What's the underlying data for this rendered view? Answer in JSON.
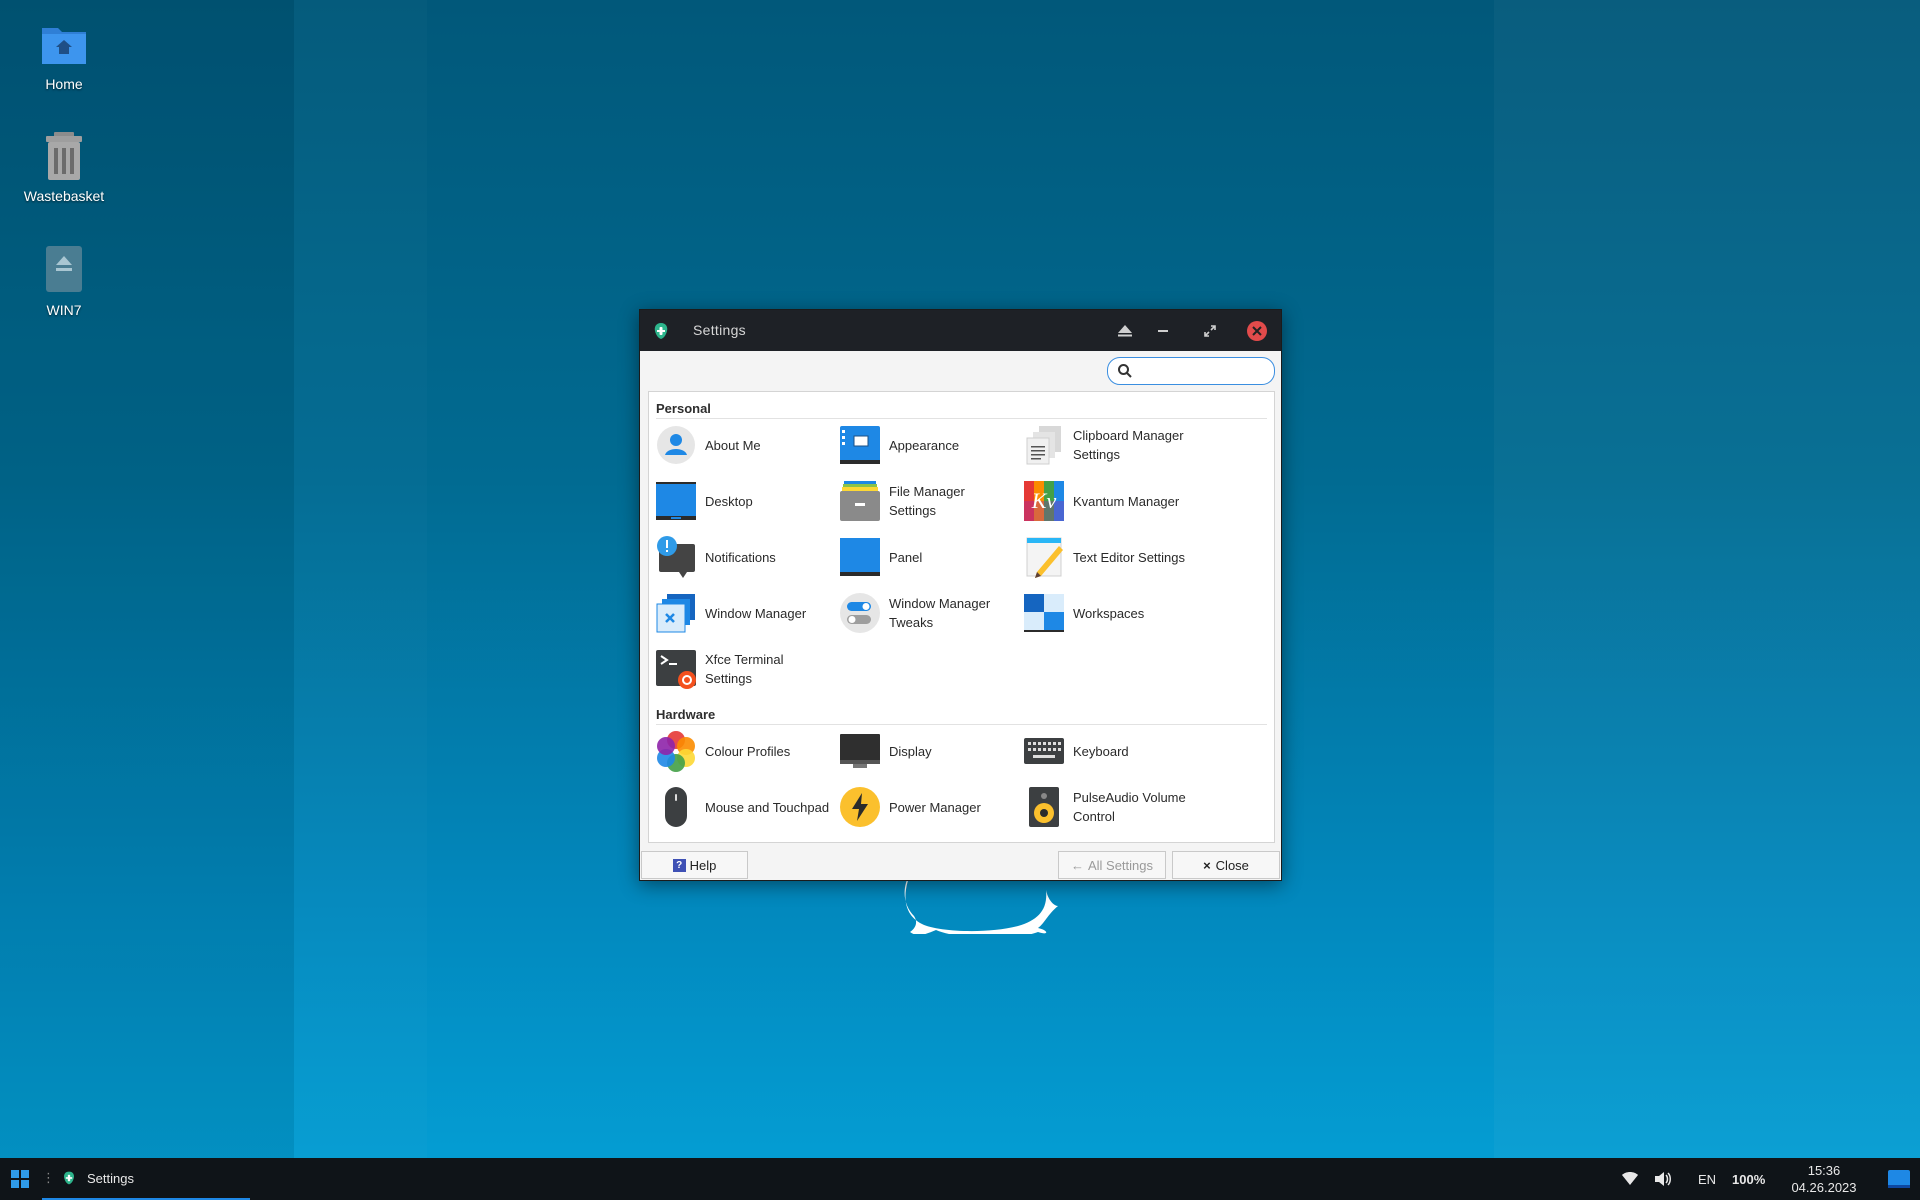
{
  "desktop": {
    "icons": [
      {
        "label": "Home"
      },
      {
        "label": "Wastebasket"
      },
      {
        "label": "WIN7"
      }
    ]
  },
  "window": {
    "title": "Settings",
    "search": {
      "placeholder": "",
      "value": ""
    },
    "sections": [
      {
        "title": "Personal",
        "items": [
          {
            "label": "About Me",
            "icon": "about-me-icon"
          },
          {
            "label": "Appearance",
            "icon": "appearance-icon"
          },
          {
            "label": "Clipboard Manager Settings",
            "icon": "clipboard-icon"
          },
          {
            "label": "Desktop",
            "icon": "desktop-icon"
          },
          {
            "label": "File Manager Settings",
            "icon": "file-manager-icon"
          },
          {
            "label": "Kvantum Manager",
            "icon": "kvantum-icon"
          },
          {
            "label": "Notifications",
            "icon": "notifications-icon"
          },
          {
            "label": "Panel",
            "icon": "panel-icon"
          },
          {
            "label": "Text Editor Settings",
            "icon": "text-editor-icon"
          },
          {
            "label": "Window Manager",
            "icon": "window-manager-icon"
          },
          {
            "label": "Window Manager Tweaks",
            "icon": "wm-tweaks-icon"
          },
          {
            "label": "Workspaces",
            "icon": "workspaces-icon"
          },
          {
            "label": "Xfce Terminal Settings",
            "icon": "terminal-icon"
          }
        ]
      },
      {
        "title": "Hardware",
        "items": [
          {
            "label": "Colour Profiles",
            "icon": "colour-profiles-icon"
          },
          {
            "label": "Display",
            "icon": "display-icon"
          },
          {
            "label": "Keyboard",
            "icon": "keyboard-icon"
          },
          {
            "label": "Mouse and Touchpad",
            "icon": "mouse-icon"
          },
          {
            "label": "Power Manager",
            "icon": "power-icon"
          },
          {
            "label": "PulseAudio Volume Control",
            "icon": "speaker-icon"
          }
        ]
      }
    ],
    "footer": {
      "help": "Help",
      "all_settings": "All Settings",
      "close": "Close"
    }
  },
  "taskbar": {
    "task_label": "Settings",
    "language": "EN",
    "battery": "100%",
    "time": "15:36",
    "date": "04.26.2023"
  },
  "colors": {
    "accent": "#1e88e5",
    "titlebar": "#1e2126",
    "close": "#e24b4b"
  }
}
